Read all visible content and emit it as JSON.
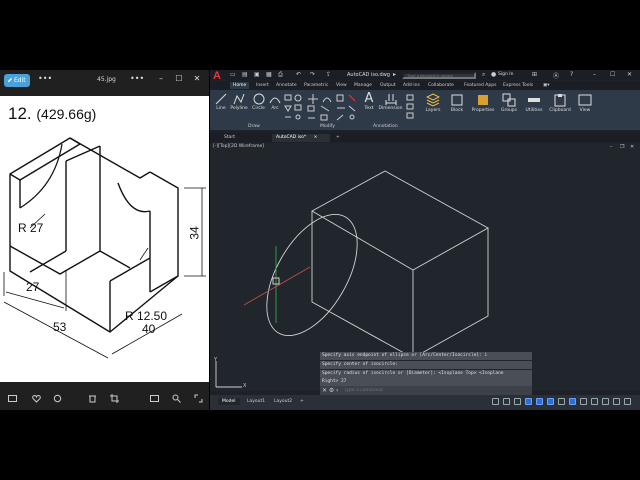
{
  "viewer": {
    "edit_label": "Edit",
    "filename": "45.jpg",
    "drawing": {
      "title_number": "12.",
      "mass": "(429.66g)",
      "dims": {
        "r_large": "R 27",
        "r_small": "R 12.50",
        "width_27": "27",
        "length_53": "53",
        "depth_40": "40",
        "height_34": "34"
      }
    }
  },
  "acad": {
    "app_letter": "A",
    "filename": "AutoCAD iso.dwg",
    "search_placeholder": "Type a keyword or phrase",
    "sign_in": "Sign In",
    "tabs": [
      "Home",
      "Insert",
      "Annotate",
      "Parametric",
      "View",
      "Manage",
      "Output",
      "Add-ins",
      "Collaborate",
      "Featured Apps",
      "Express Tools"
    ],
    "ribbon": {
      "line": "Line",
      "polyline": "Polyline",
      "circle": "Circle",
      "arc": "Arc",
      "text": "Text",
      "dimension": "Dimension",
      "layers": "Layers",
      "block": "Block",
      "properties": "Properties",
      "groups": "Groups",
      "utilities": "Utilities",
      "clipboard": "Clipboard",
      "view": "View",
      "panel_draw": "Draw",
      "panel_modify": "Modify",
      "panel_annotation": "Annotation"
    },
    "doc_tabs": {
      "start": "Start",
      "file": "AutoCAD iso*",
      "close": "×",
      "add": "+"
    },
    "viewport_label": "[-][Top][2D Wireframe]",
    "history": [
      "Specify axis endpoint of ellipse or [Arc/Center/Isocircle]: i",
      "Specify center of isocircle:",
      "Specify radius of isocircle or [Diameter]: <Isoplane Top> <Isoplane",
      "Right> 27"
    ],
    "command_placeholder": "Type a command",
    "layout_tabs": [
      "Model",
      "Layout1",
      "Layout2"
    ],
    "layout_add": "+",
    "ucs": {
      "x": "X",
      "y": "Y"
    }
  }
}
